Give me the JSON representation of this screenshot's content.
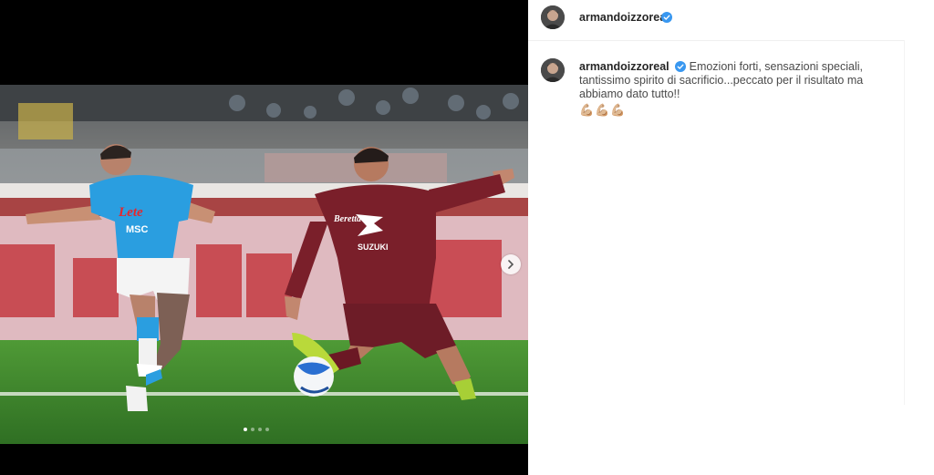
{
  "post": {
    "username": "armandoizzoreal",
    "verified": true,
    "caption": "Emozioni forti, sensazioni speciali, tantissimo spirito di sacrificio...peccato per il risultato ma abbiamo dato tutto!!",
    "caption_emojis": "💪🏼💪🏼💪🏼",
    "photo_description": "Football match photo: Napoli player in blue kit shooting, Torino player in maroon kit sliding to block",
    "carousel": {
      "total": 4,
      "active_index": 0
    }
  },
  "icons": {
    "next": "chevron-right-icon",
    "verified": "verified-badge-icon"
  },
  "colors": {
    "verified_blue": "#3897f0",
    "napoli_blue": "#2a9ee0",
    "torino_maroon": "#7a1f2a",
    "pitch_green": "#3f8a2e"
  }
}
